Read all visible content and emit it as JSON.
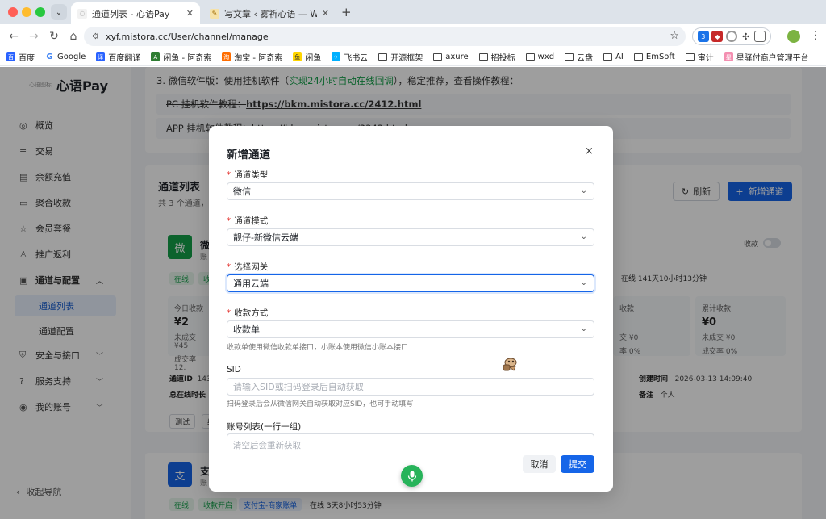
{
  "browser": {
    "tabs": [
      {
        "title": "通道列表 - 心语Pay",
        "active": true
      },
      {
        "title": "写文章 ‹ 雾祈心语 — WordPress",
        "active": false
      }
    ],
    "url": "xyf.mistora.cc/User/channel/manage",
    "ext_badge_1": "3",
    "bookmarks": [
      "百度",
      "Google",
      "百度翻译",
      "闲鱼 - 阿奇索",
      "淘宝 - 阿奇索",
      "闲鱼",
      "飞书云",
      "开源框架",
      "axure",
      "招投标",
      "wxd",
      "云盘",
      "AI",
      "EmSoft",
      "审计",
      "星驿付商户管理平台"
    ]
  },
  "sidebar": {
    "logo_small": "心语图标",
    "logo_text": "心语Pay",
    "items": [
      {
        "label": "概览",
        "icon": "◎"
      },
      {
        "label": "交易",
        "icon": "≡"
      },
      {
        "label": "余额充值",
        "icon": "▤"
      },
      {
        "label": "聚合收款",
        "icon": "▭"
      },
      {
        "label": "会员套餐",
        "icon": "☆"
      },
      {
        "label": "推广返利",
        "icon": "♙"
      },
      {
        "label": "通道与配置",
        "icon": "▣"
      },
      {
        "label": "安全与接口",
        "icon": "⛨"
      },
      {
        "label": "服务支持",
        "icon": "?"
      },
      {
        "label": "我的账号",
        "icon": "◉"
      }
    ],
    "sub_items": [
      "通道列表",
      "通道配置"
    ],
    "collapse": "收起导航"
  },
  "notice": {
    "line3_prefix": "3. 微信软件版：使用挂机软件（",
    "line3_green": "实现24小时自动在线回调",
    "line3_suffix": "），稳定推荐，查看操作教程：",
    "pc_prefix": "PC 挂机软件教程：",
    "pc_link": "https://bkm.mistora.cc/2412.html",
    "app_prefix": "APP 挂机软件教程：https://bkm.mistora.cc/2343.html"
  },
  "channel_list": {
    "title": "通道列表",
    "subtitle": "共 3 个通道，可",
    "refresh": "刷新",
    "add": "新增通道",
    "card1": {
      "icon": "微",
      "name": "微",
      "sub": "账",
      "chip_online": "在线",
      "chip_collect": "收",
      "today_label": "今日收款",
      "today_value": "¥2",
      "unpaid": "未成交 ¥45",
      "rate": "成交率 12.",
      "id_label": "通道ID",
      "id_value": "143",
      "online_label": "总在线时长",
      "online_value": "0",
      "test_btn": "测试",
      "test2": "编"
    },
    "card_right": {
      "toggle_label": "收款",
      "online_chip": "在线 141天10小时13分钟",
      "box1_label": "收款",
      "box1_unpaid": "交 ¥0",
      "box1_rate": "率 0%",
      "box2_label": "累计收款",
      "box2_value": "¥0",
      "box2_unpaid": "未成交 ¥0",
      "box2_rate": "成交率 0%",
      "created_label": "创建时间",
      "created_value": "2026-03-13 14:09:40",
      "remark_label": "备注",
      "remark_value": "个人"
    },
    "card2": {
      "icon": "支",
      "name": "支",
      "sub": "账",
      "chip_online": "在线",
      "chip_collect": "收款开启",
      "chip_type": "支付宝-商家账单",
      "online_text": "在线 3天8小时53分钟"
    }
  },
  "modal": {
    "title": "新增通道",
    "close": "×",
    "fields": {
      "channel_type_label": "通道类型",
      "channel_type_value": "微信",
      "channel_mode_label": "通道模式",
      "channel_mode_value": "靓仔-新微信云端",
      "gateway_label": "选择网关",
      "gateway_value": "通用云端",
      "pay_method_label": "收款方式",
      "pay_method_value": "收款单",
      "pay_method_help": "收款单使用微信收款单接口，小账本使用微信小账本接口",
      "sid_label": "SID",
      "sid_placeholder": "请输入SID或扫码登录后自动获取",
      "sid_help": "扫码登录后会从微信网关自动获取对应SID，也可手动填写",
      "accounts_label": "账号列表(一行一组)",
      "accounts_placeholder": "清空后会重新获取"
    },
    "cancel": "取消",
    "submit": "提交"
  },
  "colors": {
    "primary": "#1565e8",
    "success": "#14a04a",
    "required": "#e53935"
  }
}
